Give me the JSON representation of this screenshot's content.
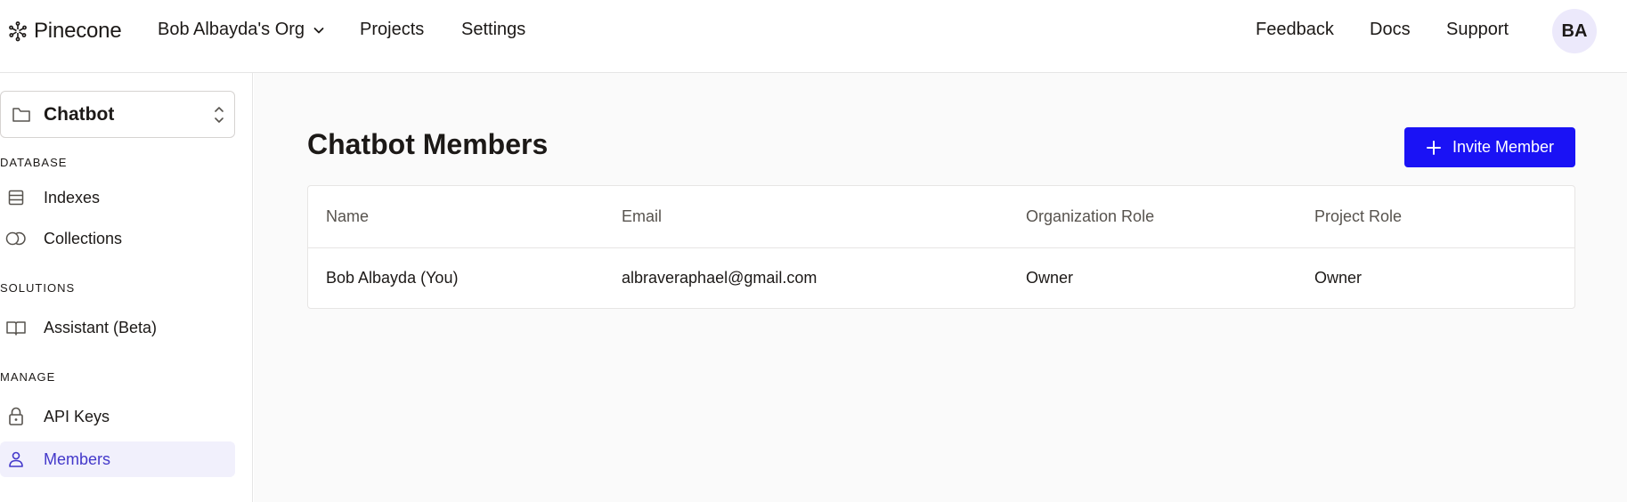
{
  "header": {
    "brand": "Pinecone",
    "org_label": "Bob Albayda's Org",
    "nav": {
      "projects": "Projects",
      "settings": "Settings",
      "feedback": "Feedback",
      "docs": "Docs",
      "support": "Support"
    },
    "avatar_initials": "BA"
  },
  "sidebar": {
    "project": "Chatbot",
    "sections": {
      "database": "DATABASE",
      "solutions": "SOLUTIONS",
      "manage": "MANAGE"
    },
    "items": {
      "indexes": "Indexes",
      "collections": "Collections",
      "assistant": "Assistant (Beta)",
      "api_keys": "API Keys",
      "members": "Members"
    },
    "active_item": "Members"
  },
  "main": {
    "title": "Chatbot Members",
    "invite_button": "Invite Member",
    "table": {
      "columns": [
        "Name",
        "Email",
        "Organization Role",
        "Project Role"
      ],
      "rows": [
        [
          "Bob Albayda (You)",
          "albraveraphael@gmail.com",
          "Owner",
          "Owner"
        ]
      ]
    }
  },
  "colors": {
    "accent": "#1a12f5",
    "active_text": "#4338ca",
    "active_bg": "#f1f0fc",
    "avatar_bg": "#ece9fb"
  }
}
